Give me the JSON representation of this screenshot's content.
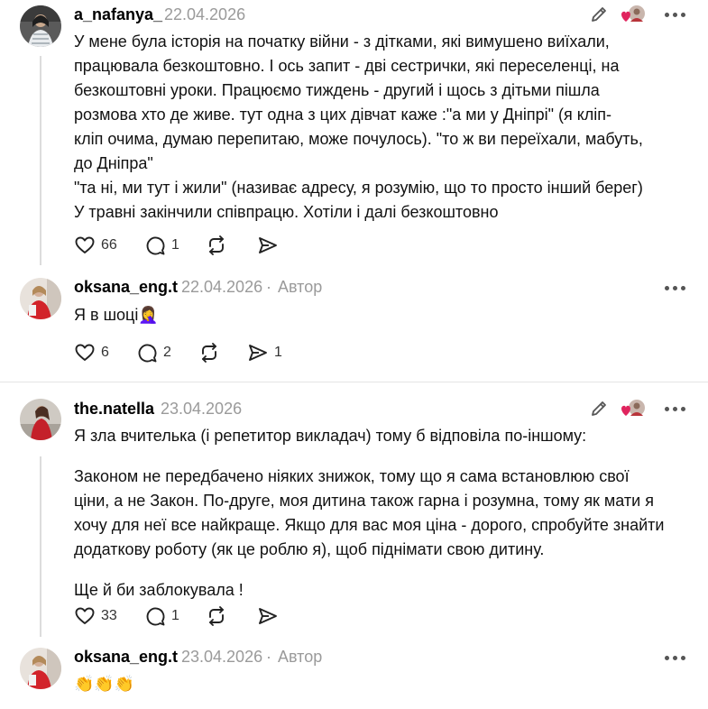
{
  "comments": [
    {
      "username": "a_nafanya_",
      "date": "22.04.2026",
      "lines": [
        "У мене була історія на початку війни - з дітками, які вимушено виїхали,",
        "працювала безкоштовно. І ось запит - дві сестрички, які переселенці, на",
        "безкоштовні уроки. Працюємо тиждень - другий і щось з дітьми пішла",
        "розмова хто де живе. тут одна з цих дівчат каже :\"а ми у Дніпрі\" (я кліп-",
        "кліп очима, думаю перепитаю, може почулось). \"то ж ви переїхали, мабуть,",
        "до Дніпра\"",
        "\"та ні, ми тут і жили\" (називає адресу, я розумію, що то просто інший берег)",
        "У травні закінчили співпрацю. Хотіли і далі безкоштовно"
      ],
      "likes": "66",
      "replies": "1",
      "reposts": "",
      "shares": ""
    },
    {
      "username": "oksana_eng.t",
      "date": "22.04.2026",
      "separator": "·",
      "author_badge": "Автор",
      "text": "Я в шоці🤦‍♀️",
      "likes": "6",
      "replies": "2",
      "reposts": "",
      "shares": "1"
    },
    {
      "username": "the.natella",
      "date": "23.04.2026",
      "paragraphs": [
        [
          "Я зла вчителька (і репетитор викладач) тому б відповіла по-іншому:"
        ],
        [
          "Законом не передбачено ніяких знижок, тому що я сама встановлюю свої",
          "ціни, а не Закон. По-друге, моя дитина також гарна і розумна, тому як мати я",
          "хочу для неї все найкраще. Якщо для вас моя ціна - дорого, спробуйте знайти",
          "додаткову роботу (як це роблю я), щоб піднімати свою дитину."
        ],
        [
          "Ще й би заблокувала !"
        ]
      ],
      "likes": "33",
      "replies": "1",
      "reposts": "",
      "shares": ""
    },
    {
      "username": "oksana_eng.t",
      "date": "23.04.2026",
      "separator": "·",
      "author_badge": "Автор",
      "text": "👏👏👏"
    }
  ],
  "icons": {
    "like": "heart-icon",
    "reply": "reply-bubble-icon",
    "repost": "repost-icon",
    "share": "share-icon",
    "edit": "edit-pencil-icon",
    "liked_by_author": "liked-by-author-icon",
    "more": "more-options-icon"
  },
  "colors": {
    "heart_accent": "#e0245e",
    "muted_text": "#9a9a9a",
    "thread_line": "#dcdcdc"
  }
}
